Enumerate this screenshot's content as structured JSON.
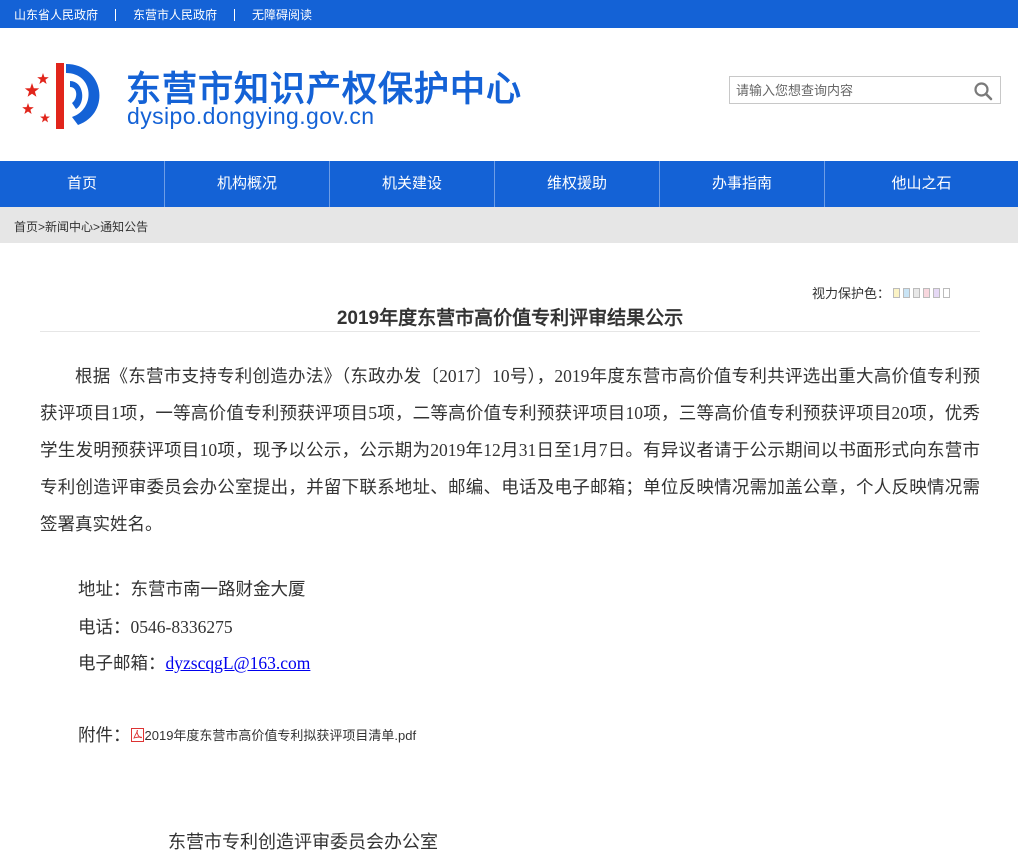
{
  "topbar": {
    "links": [
      "山东省人民政府",
      "东营市人民政府",
      "无障碍阅读"
    ]
  },
  "header": {
    "title": "东营市知识产权保护中心",
    "url": "dysipo.dongying.gov.cn",
    "search_placeholder": "请输入您想查询内容"
  },
  "nav": [
    "首页",
    "机构概况",
    "机关建设",
    "维权援助",
    "办事指南",
    "他山之石"
  ],
  "breadcrumb": {
    "home": "首页",
    "sep": ">",
    "news": "新闻中心",
    "notice": "通知公告"
  },
  "view_protect": {
    "label": "视力保护色：",
    "colors": [
      "#fbf3c5",
      "#c9e4f5",
      "#e8e8e8",
      "#f8d7de",
      "#e6d9f5",
      "#ffffff"
    ]
  },
  "article": {
    "title": "2019年度东营市高价值专利评审结果公示",
    "paragraph": "根据《东营市支持专利创造办法》（东政办发〔2017〕10号），2019年度东营市高价值专利共评选出重大高价值专利预获评项目1项，一等高价值专利预获评项目5项，二等高价值专利预获评项目10项，三等高价值专利预获评项目20项，优秀学生发明预获评项目10项，现予以公示，公示期为2019年12月31日至1月7日。有异议者请于公示期间以书面形式向东营市专利创造评审委员会办公室提出，并留下联系地址、邮编、电话及电子邮箱；单位反映情况需加盖公章，个人反映情况需签署真实姓名。",
    "address_label": "地址：",
    "address": "东营市南一路财金大厦",
    "phone_label": "电话：",
    "phone": "0546-8336275",
    "email_label": "电子邮箱：",
    "email": "dyzscqgL@163.com",
    "attach_label": "附件：",
    "attach_file": "2019年度东营市高价值专利拟获评项目清单.pdf",
    "signature": "东营市专利创造评审委员会办公室"
  }
}
